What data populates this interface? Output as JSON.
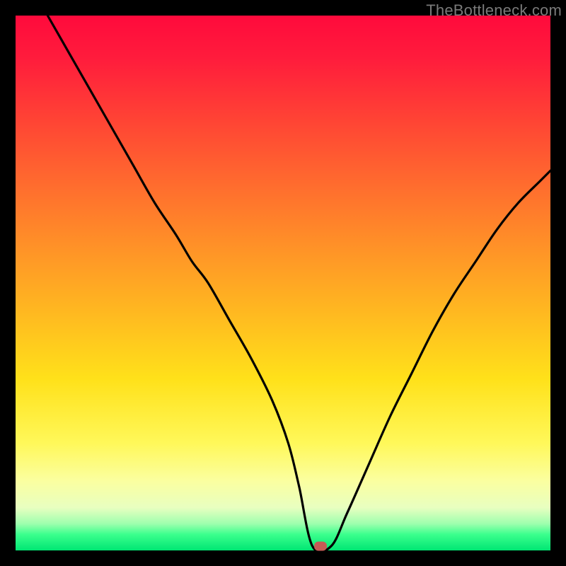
{
  "watermark": "TheBottleneck.com",
  "chart_data": {
    "type": "line",
    "title": "",
    "xlabel": "",
    "ylabel": "",
    "xlim": [
      0,
      100
    ],
    "ylim": [
      0,
      100
    ],
    "series": [
      {
        "name": "curve",
        "x": [
          6,
          10,
          14,
          18,
          22,
          26,
          30,
          33,
          36,
          40,
          44,
          48,
          51,
          53,
          55.5,
          59,
          62,
          66,
          70,
          74,
          78,
          82,
          86,
          90,
          94,
          98,
          100
        ],
        "y": [
          100,
          93,
          86,
          79,
          72,
          65,
          59,
          54,
          50,
          43,
          36,
          28,
          20,
          12,
          0.8,
          0.8,
          7,
          16,
          25,
          33,
          41,
          48,
          54,
          60,
          65,
          69,
          71
        ]
      }
    ],
    "marker": {
      "x": 57,
      "y": 0.8
    },
    "gradient_stops": [
      {
        "pos": 0,
        "color": "#ff0a3c"
      },
      {
        "pos": 8,
        "color": "#ff1c3c"
      },
      {
        "pos": 20,
        "color": "#ff4534"
      },
      {
        "pos": 32,
        "color": "#ff6d2e"
      },
      {
        "pos": 44,
        "color": "#ff9427"
      },
      {
        "pos": 56,
        "color": "#ffba20"
      },
      {
        "pos": 68,
        "color": "#ffe11a"
      },
      {
        "pos": 80,
        "color": "#fff85a"
      },
      {
        "pos": 87,
        "color": "#fbffa0"
      },
      {
        "pos": 92,
        "color": "#e8ffc0"
      },
      {
        "pos": 95,
        "color": "#9effae"
      },
      {
        "pos": 97,
        "color": "#3bff8d"
      },
      {
        "pos": 100,
        "color": "#00e673"
      }
    ]
  }
}
